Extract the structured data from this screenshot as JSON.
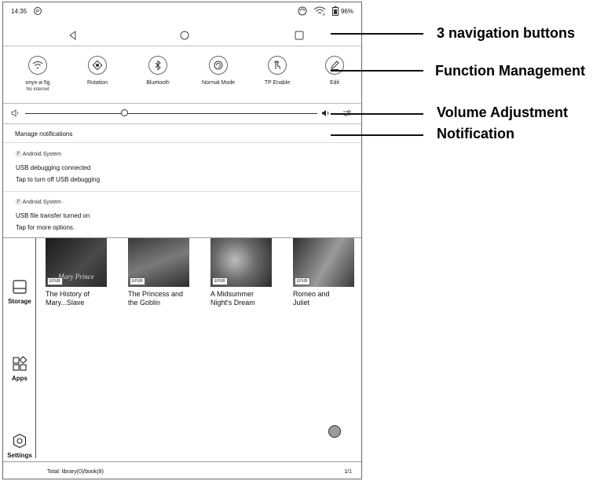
{
  "status_bar": {
    "time": "14:35",
    "battery": "96%"
  },
  "nav_bar": {
    "buttons": [
      "back-triangle",
      "home-circle",
      "recents-square"
    ]
  },
  "quick_settings": [
    {
      "label": "onyx-a-5g",
      "sub": "No internet",
      "icon": "wifi-icon"
    },
    {
      "label": "Rotation",
      "icon": "rotation-icon"
    },
    {
      "label": "Bluetooth",
      "icon": "bluetooth-icon"
    },
    {
      "label": "Normal Mode",
      "icon": "refresh-mode-icon"
    },
    {
      "label": "TP Enable",
      "icon": "touch-icon"
    },
    {
      "label": "Edit",
      "icon": "pencil-icon"
    }
  ],
  "volume": {
    "level": 0.34
  },
  "notifications": {
    "manage_label": "Manage notifications",
    "items": [
      {
        "app": "Android System",
        "line1": "USB debugging connected",
        "line2": "Tap to turn off USB debugging"
      },
      {
        "app": "Android System ·",
        "line1": "USB file transfer turned on",
        "line2": "Tap for more options."
      }
    ]
  },
  "sidebar": {
    "items": [
      {
        "label": "Storage"
      },
      {
        "label": "Apps"
      },
      {
        "label": "Settings"
      }
    ]
  },
  "books": [
    {
      "title1": "The History of",
      "title2": "Mary...Slave",
      "badge": "EPUB",
      "cover_text": "Mary Prince"
    },
    {
      "title1": "The Princess and",
      "title2": "the Goblin",
      "badge": "EPUB",
      "cover_text": ""
    },
    {
      "title1": "A Midsummer",
      "title2": "Night's Dream",
      "badge": "EPUB",
      "cover_text": ""
    },
    {
      "title1": "Romeo and",
      "title2": "Juliet",
      "badge": "EPUB",
      "cover_text": ""
    }
  ],
  "footer": {
    "total": "Total:  library(0)/book(8)",
    "page": "1/1"
  },
  "annotations": {
    "nav": "3 navigation buttons",
    "function": "Function Management",
    "volume": "Volume Adjustment",
    "notification": "Notification"
  }
}
